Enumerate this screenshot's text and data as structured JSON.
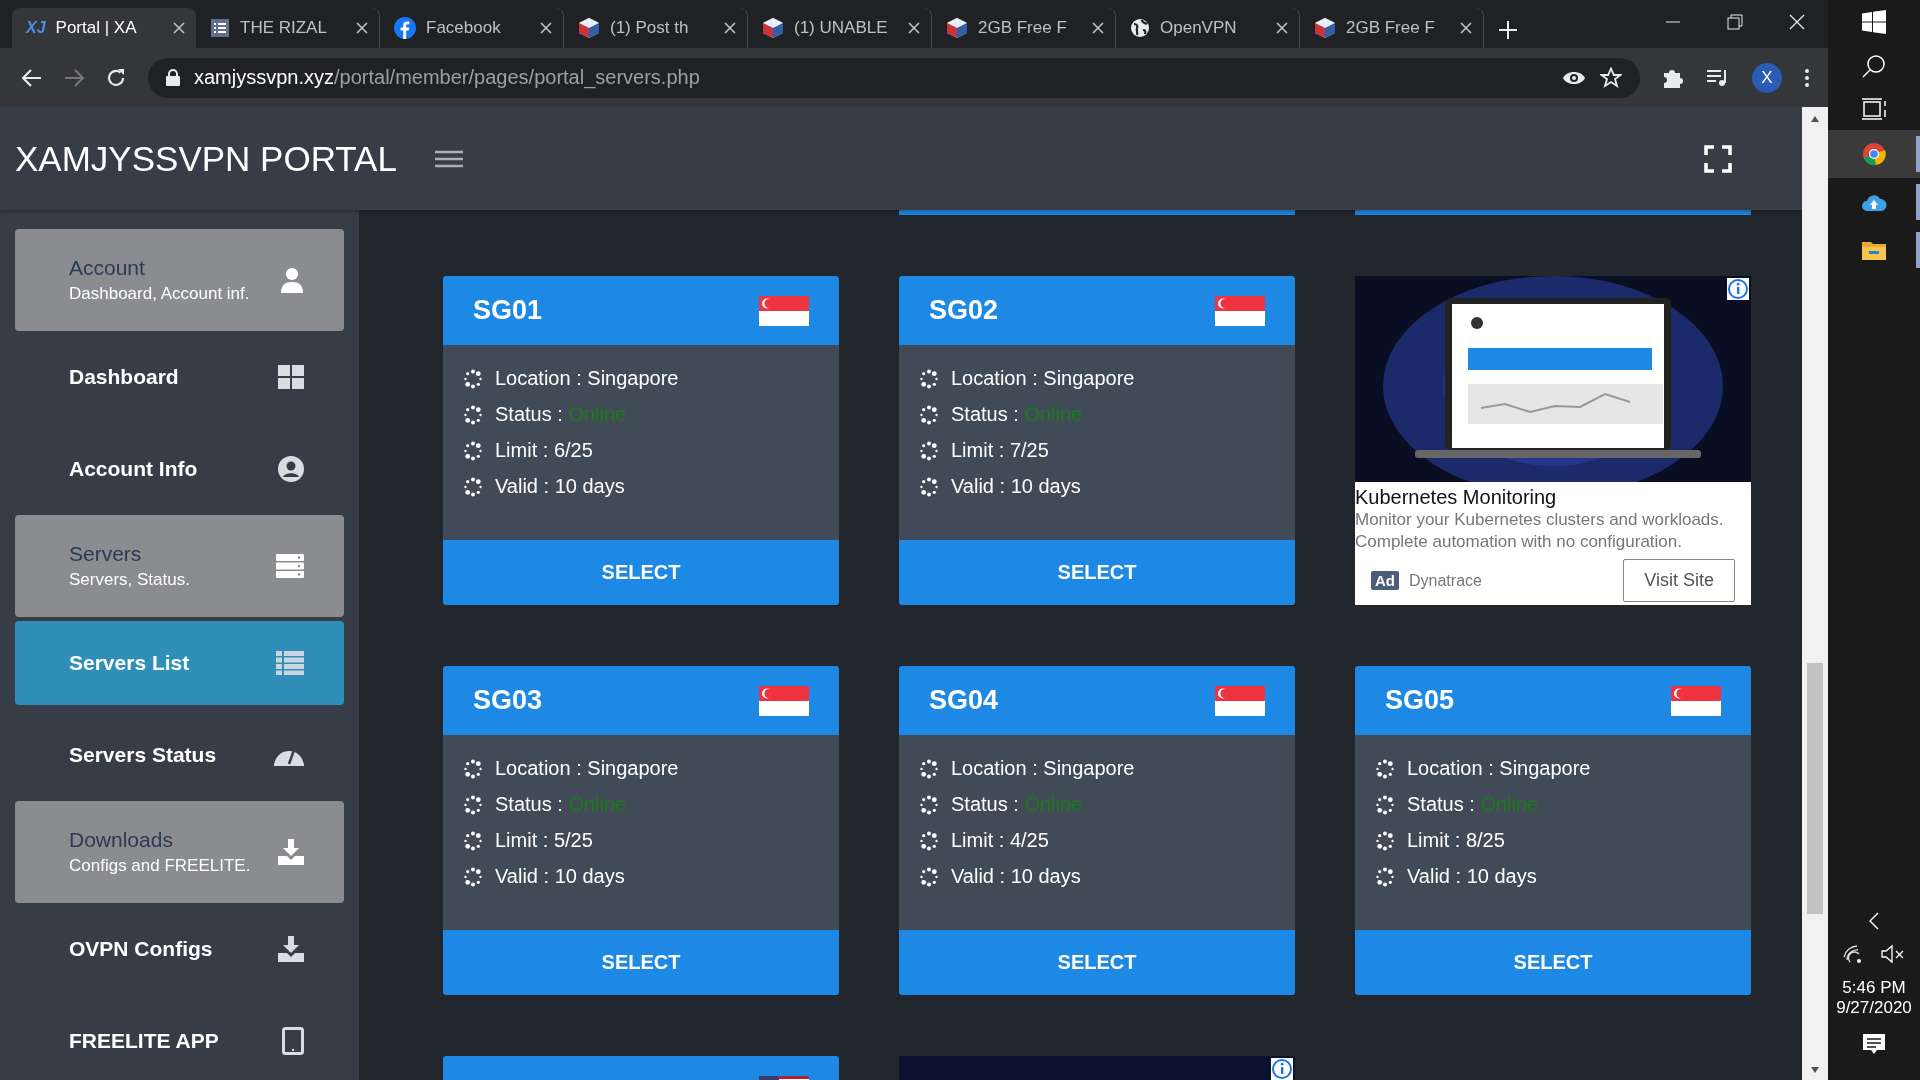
{
  "browser": {
    "tabs": [
      {
        "title": "Portal | XA",
        "favicon_text": "XJ",
        "selected": true
      },
      {
        "title": "THE RIZAL",
        "selected": false
      },
      {
        "title": "Facebook",
        "selected": false
      },
      {
        "title": "(1) Post th",
        "selected": false
      },
      {
        "title": "(1) UNABLE",
        "selected": false
      },
      {
        "title": "2GB Free F",
        "selected": false
      },
      {
        "title": "OpenVPN",
        "selected": false
      },
      {
        "title": "2GB Free F",
        "selected": false
      }
    ],
    "url_host": "xamjyssvpn.xyz",
    "url_path": "/portal/member/pages/portal_servers.php",
    "avatar": "X"
  },
  "page": {
    "title": "XAMJYSSVPN PORTAL"
  },
  "sidebar": {
    "items": [
      {
        "kind": "group",
        "title": "Account",
        "subtitle": "Dashboard, Account inf.",
        "selected": false
      },
      {
        "kind": "link",
        "title": "Dashboard",
        "selected": false
      },
      {
        "kind": "link",
        "title": "Account Info",
        "selected": false
      },
      {
        "kind": "group",
        "title": "Servers",
        "subtitle": "Servers, Status.",
        "selected": false
      },
      {
        "kind": "link",
        "title": "Servers List",
        "selected": true
      },
      {
        "kind": "link",
        "title": "Servers Status",
        "selected": false
      },
      {
        "kind": "group",
        "title": "Downloads",
        "subtitle": "Configs and FREELITE.",
        "selected": false
      },
      {
        "kind": "link",
        "title": "OVPN Configs",
        "selected": false
      },
      {
        "kind": "link",
        "title": "FREELITE APP",
        "selected": false
      }
    ]
  },
  "cards_above": [
    {
      "kind": "none"
    },
    {
      "kind": "edge"
    },
    {
      "kind": "edge"
    }
  ],
  "cards": [
    {
      "kind": "server",
      "name": "SG01",
      "location": "Location : Singapore",
      "status_label": "Status :",
      "status": "Online",
      "limit": "Limit : 6/25",
      "valid": "Valid : 10 days",
      "button": "SELECT"
    },
    {
      "kind": "server",
      "name": "SG02",
      "location": "Location : Singapore",
      "status_label": "Status :",
      "status": "Online",
      "limit": "Limit : 7/25",
      "valid": "Valid : 10 days",
      "button": "SELECT"
    },
    {
      "kind": "ad",
      "title": "Kubernetes Monitoring",
      "description": "Monitor your Kubernetes clusters and workloads. Complete automation with no configuration.",
      "badge": "Ad",
      "advertiser": "Dynatrace",
      "button": "Visit Site"
    },
    {
      "kind": "server",
      "name": "SG03",
      "location": "Location : Singapore",
      "status_label": "Status :",
      "status": "Online",
      "limit": "Limit : 5/25",
      "valid": "Valid : 10 days",
      "button": "SELECT"
    },
    {
      "kind": "server",
      "name": "SG04",
      "location": "Location : Singapore",
      "status_label": "Status :",
      "status": "Online",
      "limit": "Limit : 4/25",
      "valid": "Valid : 10 days",
      "button": "SELECT"
    },
    {
      "kind": "server",
      "name": "SG05",
      "location": "Location : Singapore",
      "status_label": "Status :",
      "status": "Online",
      "limit": "Limit : 8/25",
      "valid": "Valid : 10 days",
      "button": "SELECT"
    },
    {
      "kind": "server_cut"
    },
    {
      "kind": "ad_cut"
    },
    {
      "kind": "none"
    }
  ],
  "taskbar": {
    "apps": [
      {
        "selected": true
      },
      {
        "selected": false
      },
      {
        "selected": false
      }
    ],
    "time": "5:46 PM",
    "date": "9/27/2020"
  }
}
